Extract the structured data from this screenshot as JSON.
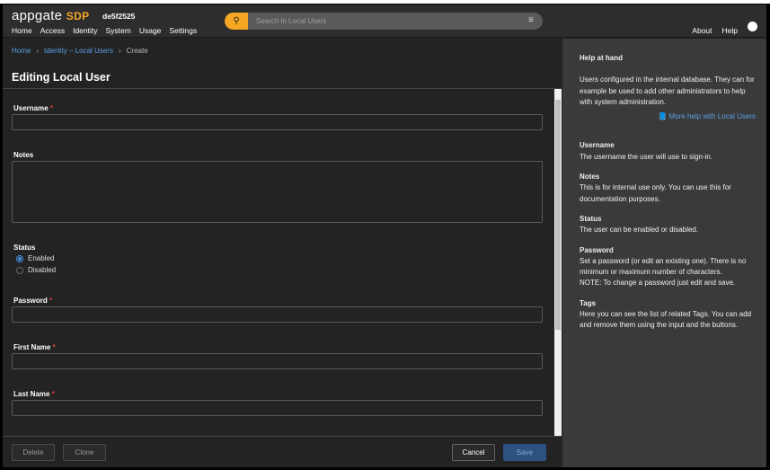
{
  "header": {
    "logo_main": "appgate",
    "logo_accent": "SDP",
    "host": "de5f2525",
    "nav": [
      "Home",
      "Access",
      "Identity",
      "System",
      "Usage",
      "Settings"
    ],
    "search_placeholder": "Search in Local Users",
    "about": "About",
    "help": "Help"
  },
  "breadcrumb": {
    "home": "Home",
    "section": "Identity – Local Users",
    "current": "Create"
  },
  "page_title": "Editing Local User",
  "form": {
    "username": "Username",
    "notes": "Notes",
    "status": "Status",
    "enabled": "Enabled",
    "disabled": "Disabled",
    "password": "Password",
    "first_name": "First Name",
    "last_name": "Last Name",
    "required_mark": "*",
    "status_value": "Enabled"
  },
  "footer": {
    "delete": "Delete",
    "clone": "Clone",
    "cancel": "Cancel",
    "save": "Save"
  },
  "help": {
    "title": "Help at hand",
    "intro": "Users configured in the internal database. They can for example be used to add other administrators to help with system administration.",
    "more": "More help with Local Users",
    "sections": [
      {
        "title": "Username",
        "text": "The username the user will use to sign-in."
      },
      {
        "title": "Notes",
        "text": "This is for internal use only. You can use this for documentation purposes."
      },
      {
        "title": "Status",
        "text": "The user can be enabled or disabled."
      },
      {
        "title": "Password",
        "text": "Set a password (or edit an existing one). There is no minimum or maximum number of characters.",
        "note": "NOTE: To change a password just edit and save."
      },
      {
        "title": "Tags",
        "text": "Here you can see the list of related Tags. You can add and remove them using the input and the buttons."
      }
    ]
  }
}
